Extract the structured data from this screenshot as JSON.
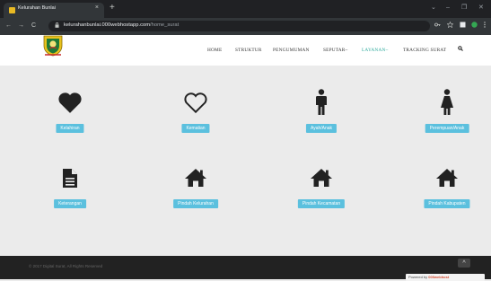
{
  "browser": {
    "tab_title": "Kelurahan Bunlai",
    "tab_close": "×",
    "new_tab": "+",
    "url_host": "kelurahanbunlai.000webhostapp.com",
    "url_path": "/home_surat",
    "back": "←",
    "forward": "→",
    "reload": "C",
    "lock": "🔒",
    "window_controls": [
      "⌄",
      "–",
      "❐",
      "✕"
    ]
  },
  "navbar": {
    "menu": [
      "HOME",
      "STRUKTUR",
      "PENGUMUMAN",
      "SEPUTAR~",
      "LAYANAN~",
      "TRACKING SURAT"
    ],
    "search_icon": "search-icon"
  },
  "cards": [
    {
      "label": "Kelahiran",
      "icon": "heart-filled-icon"
    },
    {
      "label": "Kematian",
      "icon": "heart-outline-icon"
    },
    {
      "label": "Ayah/Anak",
      "icon": "male-icon"
    },
    {
      "label": "Perempuan/Anak",
      "icon": "female-icon"
    },
    {
      "label": "Keterangan",
      "icon": "document-icon"
    },
    {
      "label": "Pindah Kelurahan",
      "icon": "home-icon"
    },
    {
      "label": "Pindah Kecamatan",
      "icon": "home-icon"
    },
    {
      "label": "Pindah Kabupaten",
      "icon": "home-icon"
    }
  ],
  "footer": {
    "copyright": "© 2017 Digital Surat, All Rights Reserved",
    "to_top": "^",
    "powered_prefix": "Powered by",
    "powered_brand": "000webhost"
  },
  "colors": {
    "accent_button": "#5bc0de",
    "menu_active": "#2aa89a",
    "footer": "#222222",
    "page_bg": "#ebebeb"
  }
}
